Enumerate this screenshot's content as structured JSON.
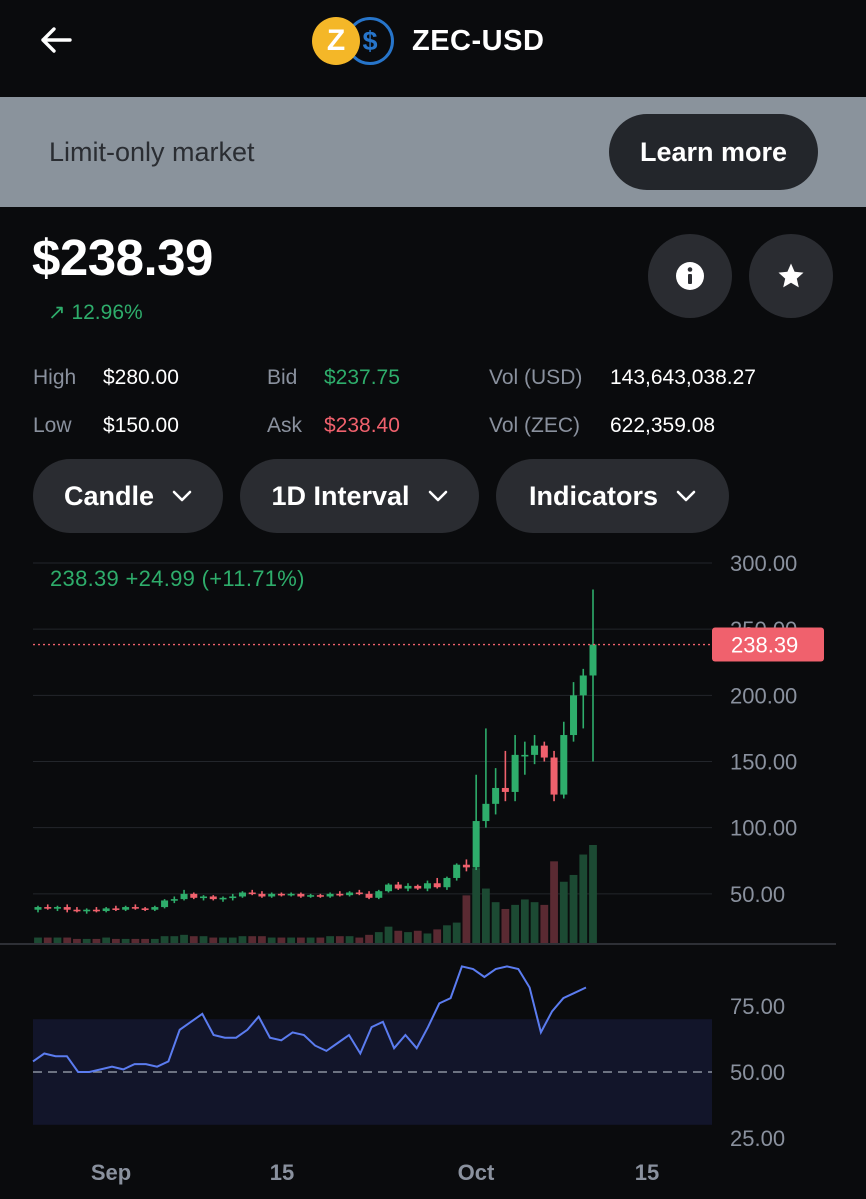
{
  "header": {
    "pair": "ZEC-USD",
    "base_icon_glyph": "Z",
    "quote_icon_glyph": "$",
    "base_color": "#f4b728",
    "quote_color": "#2775ca"
  },
  "banner": {
    "text": "Limit-only market",
    "button_label": "Learn more"
  },
  "price": {
    "value": "$238.39",
    "change_arrow": "↗",
    "change": "12.96%"
  },
  "stats": {
    "high_label": "High",
    "high_value": "$280.00",
    "low_label": "Low",
    "low_value": "$150.00",
    "bid_label": "Bid",
    "bid_value": "$237.75",
    "ask_label": "Ask",
    "ask_value": "$238.40",
    "vol_usd_label": "Vol (USD)",
    "vol_usd_value": "143,643,038.27",
    "vol_zec_label": "Vol (ZEC)",
    "vol_zec_value": "622,359.08"
  },
  "controls": {
    "chart_type": "Candle",
    "interval": "1D Interval",
    "indicators": "Indicators"
  },
  "icons": {
    "back": "arrow-left-icon",
    "info": "info-icon",
    "star": "star-icon",
    "chevron": "chevron-down-icon"
  },
  "colors": {
    "up": "#2ead6b",
    "down": "#f0616d",
    "rsi": "#5b7cf0"
  },
  "chart_data": {
    "type": "candlestick",
    "legend": "238.39  +24.99 (+11.71%)",
    "last_price_label": "238.39",
    "last_price": 238.39,
    "price_axis_ticks": [
      "300.00",
      "250.00",
      "200.00",
      "150.00",
      "100.00",
      "50.00"
    ],
    "price_ylim": [
      0,
      300
    ],
    "x_ticks": [
      "Sep",
      "15",
      "Oct",
      "15"
    ],
    "candles": [
      {
        "o": 38,
        "h": 41,
        "l": 36,
        "c": 40
      },
      {
        "o": 40,
        "h": 42,
        "l": 38,
        "c": 39
      },
      {
        "o": 39,
        "h": 41,
        "l": 37,
        "c": 40
      },
      {
        "o": 40,
        "h": 42,
        "l": 36,
        "c": 38
      },
      {
        "o": 38,
        "h": 40,
        "l": 36,
        "c": 37
      },
      {
        "o": 37,
        "h": 39,
        "l": 35,
        "c": 38
      },
      {
        "o": 38,
        "h": 40,
        "l": 36,
        "c": 37
      },
      {
        "o": 37,
        "h": 40,
        "l": 36,
        "c": 39
      },
      {
        "o": 39,
        "h": 41,
        "l": 37,
        "c": 38
      },
      {
        "o": 38,
        "h": 41,
        "l": 37,
        "c": 40
      },
      {
        "o": 40,
        "h": 42,
        "l": 38,
        "c": 39
      },
      {
        "o": 39,
        "h": 40,
        "l": 37,
        "c": 38
      },
      {
        "o": 38,
        "h": 41,
        "l": 37,
        "c": 40
      },
      {
        "o": 40,
        "h": 46,
        "l": 39,
        "c": 45
      },
      {
        "o": 45,
        "h": 48,
        "l": 43,
        "c": 46
      },
      {
        "o": 46,
        "h": 53,
        "l": 45,
        "c": 50
      },
      {
        "o": 50,
        "h": 51,
        "l": 46,
        "c": 47
      },
      {
        "o": 47,
        "h": 49,
        "l": 45,
        "c": 48
      },
      {
        "o": 48,
        "h": 49,
        "l": 45,
        "c": 46
      },
      {
        "o": 46,
        "h": 48,
        "l": 44,
        "c": 47
      },
      {
        "o": 47,
        "h": 50,
        "l": 45,
        "c": 48
      },
      {
        "o": 48,
        "h": 52,
        "l": 47,
        "c": 51
      },
      {
        "o": 51,
        "h": 53,
        "l": 49,
        "c": 50
      },
      {
        "o": 50,
        "h": 52,
        "l": 47,
        "c": 48
      },
      {
        "o": 48,
        "h": 51,
        "l": 47,
        "c": 50
      },
      {
        "o": 50,
        "h": 51,
        "l": 48,
        "c": 49
      },
      {
        "o": 49,
        "h": 51,
        "l": 48,
        "c": 50
      },
      {
        "o": 50,
        "h": 51,
        "l": 47,
        "c": 48
      },
      {
        "o": 48,
        "h": 50,
        "l": 47,
        "c": 49
      },
      {
        "o": 49,
        "h": 50,
        "l": 47,
        "c": 48
      },
      {
        "o": 48,
        "h": 51,
        "l": 47,
        "c": 50
      },
      {
        "o": 50,
        "h": 52,
        "l": 48,
        "c": 49
      },
      {
        "o": 49,
        "h": 52,
        "l": 48,
        "c": 51
      },
      {
        "o": 51,
        "h": 53,
        "l": 49,
        "c": 50
      },
      {
        "o": 50,
        "h": 52,
        "l": 46,
        "c": 47
      },
      {
        "o": 47,
        "h": 53,
        "l": 46,
        "c": 52
      },
      {
        "o": 52,
        "h": 58,
        "l": 51,
        "c": 57
      },
      {
        "o": 57,
        "h": 59,
        "l": 53,
        "c": 54
      },
      {
        "o": 54,
        "h": 58,
        "l": 52,
        "c": 56
      },
      {
        "o": 56,
        "h": 57,
        "l": 53,
        "c": 54
      },
      {
        "o": 54,
        "h": 60,
        "l": 52,
        "c": 58
      },
      {
        "o": 58,
        "h": 62,
        "l": 54,
        "c": 55
      },
      {
        "o": 55,
        "h": 63,
        "l": 53,
        "c": 62
      },
      {
        "o": 62,
        "h": 73,
        "l": 60,
        "c": 72
      },
      {
        "o": 72,
        "h": 76,
        "l": 67,
        "c": 70
      },
      {
        "o": 70,
        "h": 140,
        "l": 68,
        "c": 105
      },
      {
        "o": 105,
        "h": 175,
        "l": 100,
        "c": 118
      },
      {
        "o": 118,
        "h": 145,
        "l": 110,
        "c": 130
      },
      {
        "o": 130,
        "h": 158,
        "l": 120,
        "c": 127
      },
      {
        "o": 127,
        "h": 170,
        "l": 120,
        "c": 155
      },
      {
        "o": 155,
        "h": 165,
        "l": 140,
        "c": 155
      },
      {
        "o": 155,
        "h": 170,
        "l": 148,
        "c": 162
      },
      {
        "o": 162,
        "h": 165,
        "l": 150,
        "c": 153
      },
      {
        "o": 153,
        "h": 158,
        "l": 120,
        "c": 125
      },
      {
        "o": 125,
        "h": 180,
        "l": 122,
        "c": 170
      },
      {
        "o": 170,
        "h": 210,
        "l": 165,
        "c": 200
      },
      {
        "o": 200,
        "h": 220,
        "l": 175,
        "c": 215
      },
      {
        "o": 215,
        "h": 280,
        "l": 150,
        "c": 238.39
      }
    ],
    "volumes": [
      4,
      4,
      4,
      4,
      3,
      3,
      3,
      4,
      3,
      3,
      3,
      3,
      3,
      5,
      5,
      6,
      5,
      5,
      4,
      4,
      4,
      5,
      5,
      5,
      4,
      4,
      4,
      4,
      4,
      4,
      5,
      5,
      5,
      4,
      6,
      8,
      12,
      9,
      8,
      9,
      7,
      10,
      13,
      15,
      35,
      55,
      40,
      30,
      25,
      28,
      32,
      30,
      28,
      60,
      45,
      50,
      65,
      72
    ],
    "rsi": {
      "ticks": [
        "75.00",
        "50.00",
        "25.00"
      ],
      "ylim": [
        20,
        95
      ],
      "band": [
        30,
        70
      ],
      "midline": 50,
      "values": [
        54,
        57,
        56,
        56,
        50,
        50,
        51,
        52,
        51,
        53,
        53,
        52,
        54,
        66,
        69,
        72,
        64,
        63,
        63,
        66,
        71,
        63,
        62,
        65,
        64,
        60,
        58,
        61,
        64,
        57,
        67,
        69,
        59,
        64,
        59,
        67,
        76,
        78,
        90,
        89,
        86,
        89,
        90,
        89,
        82,
        65,
        73,
        78,
        80,
        82
      ]
    }
  }
}
